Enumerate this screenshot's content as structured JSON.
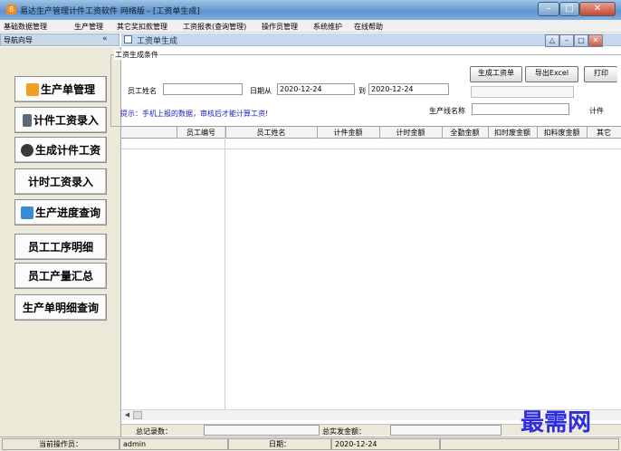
{
  "window": {
    "title": "易达生产管理计件工资软件 网络版  - [工资单生成]",
    "app_icon": "8"
  },
  "menu": [
    "基础数据管理",
    "生产管理",
    "其它奖扣款管理",
    "工资报表(查询管理)",
    "操作员管理",
    "系统维护",
    "在线帮助"
  ],
  "nav": {
    "title": "导航向导",
    "collapse": "«",
    "items": [
      {
        "label": "生产单管理",
        "icon": "folder-icon",
        "color": "#f0a020"
      },
      {
        "label": "计件工资录入",
        "icon": "edit-icon",
        "color": "#5a6a7a"
      },
      {
        "label": "生成计件工资",
        "icon": "money-bag-icon",
        "color": "#3a3a3a"
      },
      {
        "label": "计时工资录入",
        "icon": "",
        "color": ""
      },
      {
        "label": "生产进度查询",
        "icon": "chart-icon",
        "color": "#3a8ad8"
      },
      {
        "label": "员工工序明细",
        "icon": "",
        "color": ""
      },
      {
        "label": "员工产量汇总",
        "icon": "",
        "color": ""
      },
      {
        "label": "生产单明细查询",
        "icon": "",
        "color": ""
      }
    ]
  },
  "child": {
    "title": "工资单生成"
  },
  "conditions": {
    "group_label": "工资生成条件",
    "employee_label": "员工姓名",
    "employee_value": "",
    "date_from_label": "日期从",
    "date_from": "2020-12-24",
    "date_to_label": "到",
    "date_to": "2020-12-24",
    "line_label": "生产线名称",
    "line_value": "",
    "buttons": {
      "generate": "生成工资单",
      "export": "导出Excel",
      "print": "打印",
      "piece": "计件"
    },
    "hint": "提示：手机上报的数据，审核后才能计算工资!"
  },
  "grid": {
    "columns": [
      "",
      "员工编号",
      "员工姓名",
      "计件金额",
      "计时金额",
      "全勤金额",
      "扣时废金额",
      "扣料废金额",
      "其它"
    ]
  },
  "summary": {
    "total_records_label": "总记录数：",
    "total_records": "",
    "total_pay_label": "总实发金额：",
    "total_pay": ""
  },
  "status": {
    "operator_label": "当前操作员：",
    "operator": "admin",
    "date_label": "日期：",
    "date": "2020-12-24"
  },
  "watermark": "最需网",
  "colors": {
    "title_bar": "#6d9fd2",
    "nav_bg": "#ece9d8",
    "hint_text": "#2020c0",
    "watermark": "#2c2ce0"
  }
}
